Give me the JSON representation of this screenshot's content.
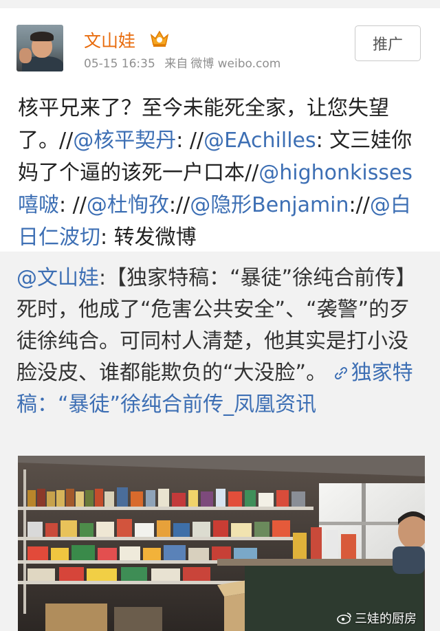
{
  "author": {
    "name": "文山娃",
    "timestamp": "05-15 16:35",
    "source_prefix": "来自",
    "source": "微博 weibo.com"
  },
  "header": {
    "promote_label": "推广"
  },
  "post": {
    "text_1": "核平兄来了？至今未能死全家，让您失望了。//",
    "mention_1": "@核平契丹",
    "text_2": ": //",
    "mention_2": "@EAchilles",
    "text_3": ": 文三娃你妈了个逼的该死一户口本//",
    "mention_3": "@highonkisses嘻啵",
    "text_4": ": //",
    "mention_4": "@杜恂孜",
    "text_5": "://",
    "mention_5": "@隐形Benjamin",
    "text_6": "://",
    "mention_6": "@白日仁波切",
    "text_7": ": 转发微博"
  },
  "repost": {
    "author_mention": "@文山娃",
    "colon": ":",
    "body": "【独家特稿：“暴徒”徐纯合前传】死时，他成了“危害公共安全”、“袭警”的歹徒徐纯合。可同村人清楚，他其实是打小没脸没皮、谁都能欺负的“大没脸”。",
    "link_text": "独家特稿：“暴徒”徐纯合前传_凤凰资讯",
    "watermark": "三娃的厨房"
  },
  "colors": {
    "username": "#e86b0c",
    "mention": "#3d6fb4",
    "repost_bg": "#f2f2f2",
    "meta": "#8f8f8f"
  },
  "icons": {
    "vip": "crown-vip-icon",
    "link": "link-chain-icon",
    "weibo": "weibo-logo-icon"
  }
}
